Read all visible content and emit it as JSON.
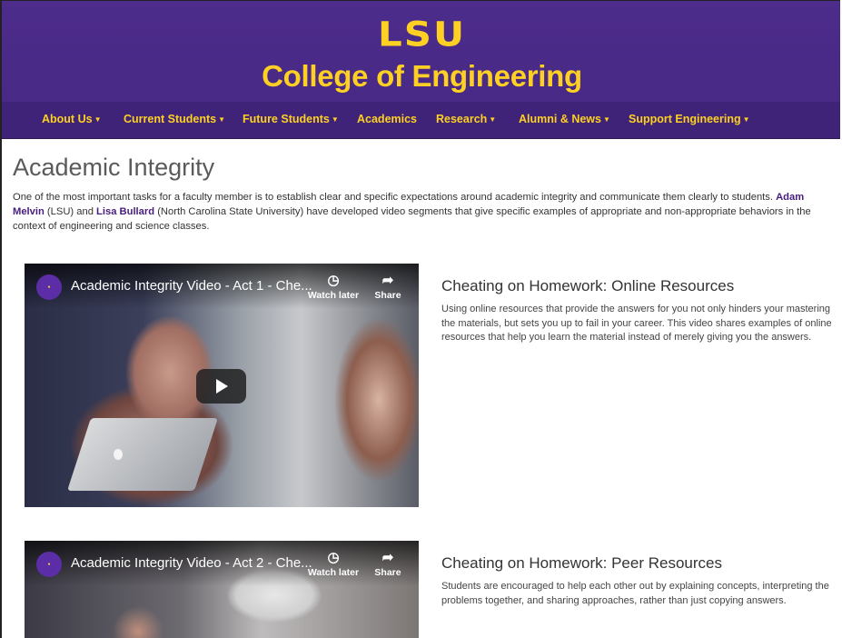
{
  "header": {
    "logo_text": "LSU",
    "college_name": "College of Engineering",
    "colors": {
      "purple": "#4a2a86",
      "gold": "#fdd023"
    }
  },
  "nav": {
    "items": [
      {
        "label": "About Us",
        "dropdown": true
      },
      {
        "label": "Current Students",
        "dropdown": true
      },
      {
        "label": "Future Students",
        "dropdown": true
      },
      {
        "label": "Academics",
        "dropdown": false
      },
      {
        "label": "Research",
        "dropdown": true
      },
      {
        "label": "Alumni & News",
        "dropdown": true
      },
      {
        "label": "Support Engineering",
        "dropdown": true
      }
    ]
  },
  "main": {
    "title": "Academic Integrity",
    "intro": {
      "before_link1": "One of the most important tasks for a faculty member is to establish clear and specific expectations around academic integrity and communicate them clearly to students. ",
      "link1": "Adam Melvin",
      "between": " (LSU) and ",
      "link2": "Lisa Bullard",
      "after_link2": " (North Carolina State University) have developed video segments that give specific examples of appropriate and non-appropriate behaviors in the context of engineering and science classes."
    },
    "sections": [
      {
        "video_title": "Academic Integrity Video - Act 1 - Che...",
        "heading": "Cheating on Homework: Online Resources",
        "description": "Using online resources that provide the answers for you not only hinders your mastering the materials, but sets you up to fail in your career. This video shares examples of online resources that help you learn the material instead of merely giving you the answers."
      },
      {
        "video_title": "Academic Integrity Video - Act 2 - Che...",
        "heading": "Cheating on Homework: Peer Resources",
        "description": "Students are encouraged to help each other out by explaining concepts, interpreting the problems together, and sharing approaches, rather than just copying answers."
      }
    ],
    "video_controls": {
      "watch_later": "Watch later",
      "share": "Share",
      "icons": [
        "clock-icon",
        "share-arrow-icon",
        "play-icon"
      ]
    }
  }
}
